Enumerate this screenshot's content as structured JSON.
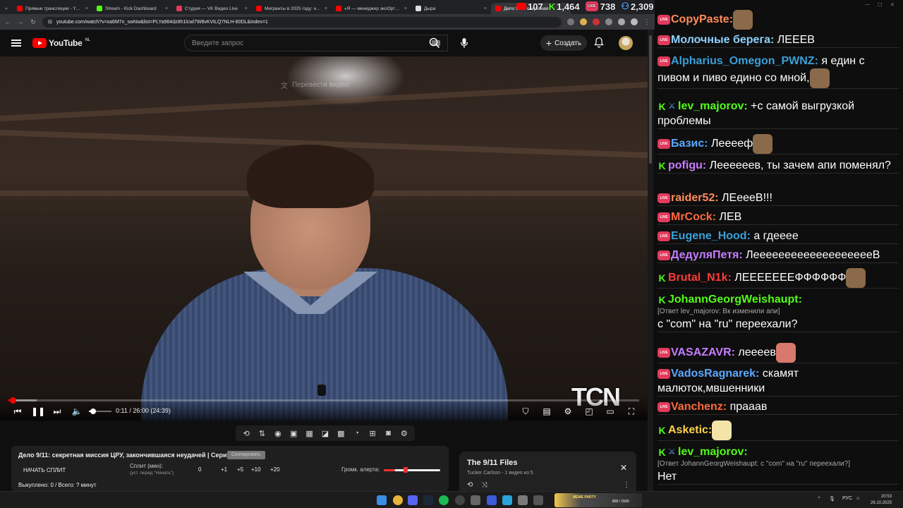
{
  "browser": {
    "tabs": [
      {
        "title": "Прямые трансляции - YouTube",
        "color": "#ff0000"
      },
      {
        "title": "Stream - Kick Dashboard",
        "color": "#53fc18"
      },
      {
        "title": "Студия — VK Видео Live",
        "color": "#e23a5b"
      },
      {
        "title": "Мигранты в 2025 году: неза",
        "color": "#ff0000"
      },
      {
        "title": "«Я — менеджер экоОртицы",
        "color": "#ff0000"
      },
      {
        "title": "Дыра",
        "color": "#dddddd"
      },
      {
        "title": "Дело 9/11: секретная",
        "color": "#ff0000"
      }
    ],
    "url": "youtube.com/watch?v=xa6M7n_swNw&list=PLYa964dz8h1lcwl7W8vKVtLQ7NLH-80DL&index=1"
  },
  "youtube": {
    "logo": "YouTube",
    "region": "NL",
    "search_placeholder": "Введите запрос",
    "create_label": "Создать",
    "translate_hint": "Перевести видео",
    "watermark": "TCN",
    "player": {
      "time_text": "0:11 / 26:00 (24:39)",
      "progress_fraction": 0.007,
      "buffered_fraction": 0.045,
      "volume_fraction": 0.2
    }
  },
  "split_panel": {
    "title": "Дело 9/11: секретная миссия ЦРУ, закончившаяся неудачей | Серия 1",
    "tag": "Скопировать",
    "start_label": "НАЧАТЬ СПЛИТ",
    "split_label": "Сплит (мин):",
    "split_hint": "(уст. перед \"Начать\")",
    "steps": [
      "0",
      "+1",
      "+5",
      "+10",
      "+20"
    ],
    "alert_label": "Громк. алерта:",
    "alert_fraction": 0.2,
    "total": "Выкуплено: 0 / Всего: ? минут"
  },
  "playlist": {
    "title": "The 9/11 Files",
    "subtitle": "Tucker Carlson - 1 видео из 5"
  },
  "chat": {
    "stats": [
      {
        "platform": "youtube",
        "count": "107"
      },
      {
        "platform": "kick",
        "count": "1,464"
      },
      {
        "platform": "vk",
        "count": "738"
      },
      {
        "platform": "total",
        "count": "2,309"
      }
    ],
    "messages": [
      {
        "platform": "vk",
        "nick": "CopyPaste:",
        "color": "#ff8c5a",
        "text": "",
        "emote": true
      },
      {
        "platform": "vk",
        "nick": "Молочные берега:",
        "color": "#8fd0ff",
        "text": " ЛЕЕЕВ"
      },
      {
        "platform": "vk",
        "nick": "Alpharius_Omegon_PWNZ:",
        "color": "#3aa0d8",
        "text": " я един с пивом и пиво едино со мной,"
      },
      {
        "platform": "kick",
        "nick": "lev_majorov:",
        "color": "#53fc18",
        "text": " +с самой выгрузкой проблемы"
      },
      {
        "platform": "vk",
        "nick": "Базис:",
        "color": "#5aa9ff",
        "text": " Лееееф"
      },
      {
        "platform": "kick",
        "nick": "pofigu:",
        "color": "#c77dff",
        "text": " Леееееев, ты зачем апи поменял?"
      },
      {
        "platform": "vk",
        "nick": "raider52:",
        "color": "#ff8c5a",
        "text": " ЛЕеееВ!!!"
      },
      {
        "platform": "vk",
        "nick": "MrCock:",
        "color": "#ff6a3d",
        "text": " ЛЕВ"
      },
      {
        "platform": "vk",
        "nick": "Eugene_Hood:",
        "color": "#3aa0d8",
        "text": " а гдееее"
      },
      {
        "platform": "vk",
        "nick": "ДедуляПетя:",
        "color": "#c77dff",
        "text": " ЛеееееееееееееееееееВ"
      },
      {
        "platform": "kick",
        "nick": "Brutal_N1k:",
        "color": "#ff3b3b",
        "text": " ЛЕЕЕЕЕЕЕФФФФФФ"
      },
      {
        "platform": "kick",
        "nick": "JohannGeorgWeishaupt:",
        "color": "#53fc18",
        "reply": "[Ответ lev_majorov: Вк изменили апи]",
        "text": "с \"com\" на \"ru\" переехали?"
      },
      {
        "platform": "vk",
        "nick": "VASAZAVR:",
        "color": "#c77dff",
        "text": " леееев"
      },
      {
        "platform": "vk",
        "nick": "VadosRagnarek:",
        "color": "#5aa9ff",
        "text": " скамят малюток,мвшенники"
      },
      {
        "platform": "vk",
        "nick": "Vanchenz:",
        "color": "#ff6a3d",
        "text": " прааав"
      },
      {
        "platform": "kick",
        "nick": "Asketic:",
        "color": "#ffd24a",
        "text": ""
      },
      {
        "platform": "kick",
        "nick": "lev_majorov:",
        "color": "#53fc18",
        "reply": "[Ответ JohannGeorgWeishaupt: с \"com\" на \"ru\" переехали?]",
        "text": "Нет"
      }
    ]
  },
  "taskbar": {
    "banner": "MEME PARTY",
    "banner_count": "800 / 1500",
    "lang": "РУС",
    "time": "20:53",
    "date": "26.10.2025"
  }
}
